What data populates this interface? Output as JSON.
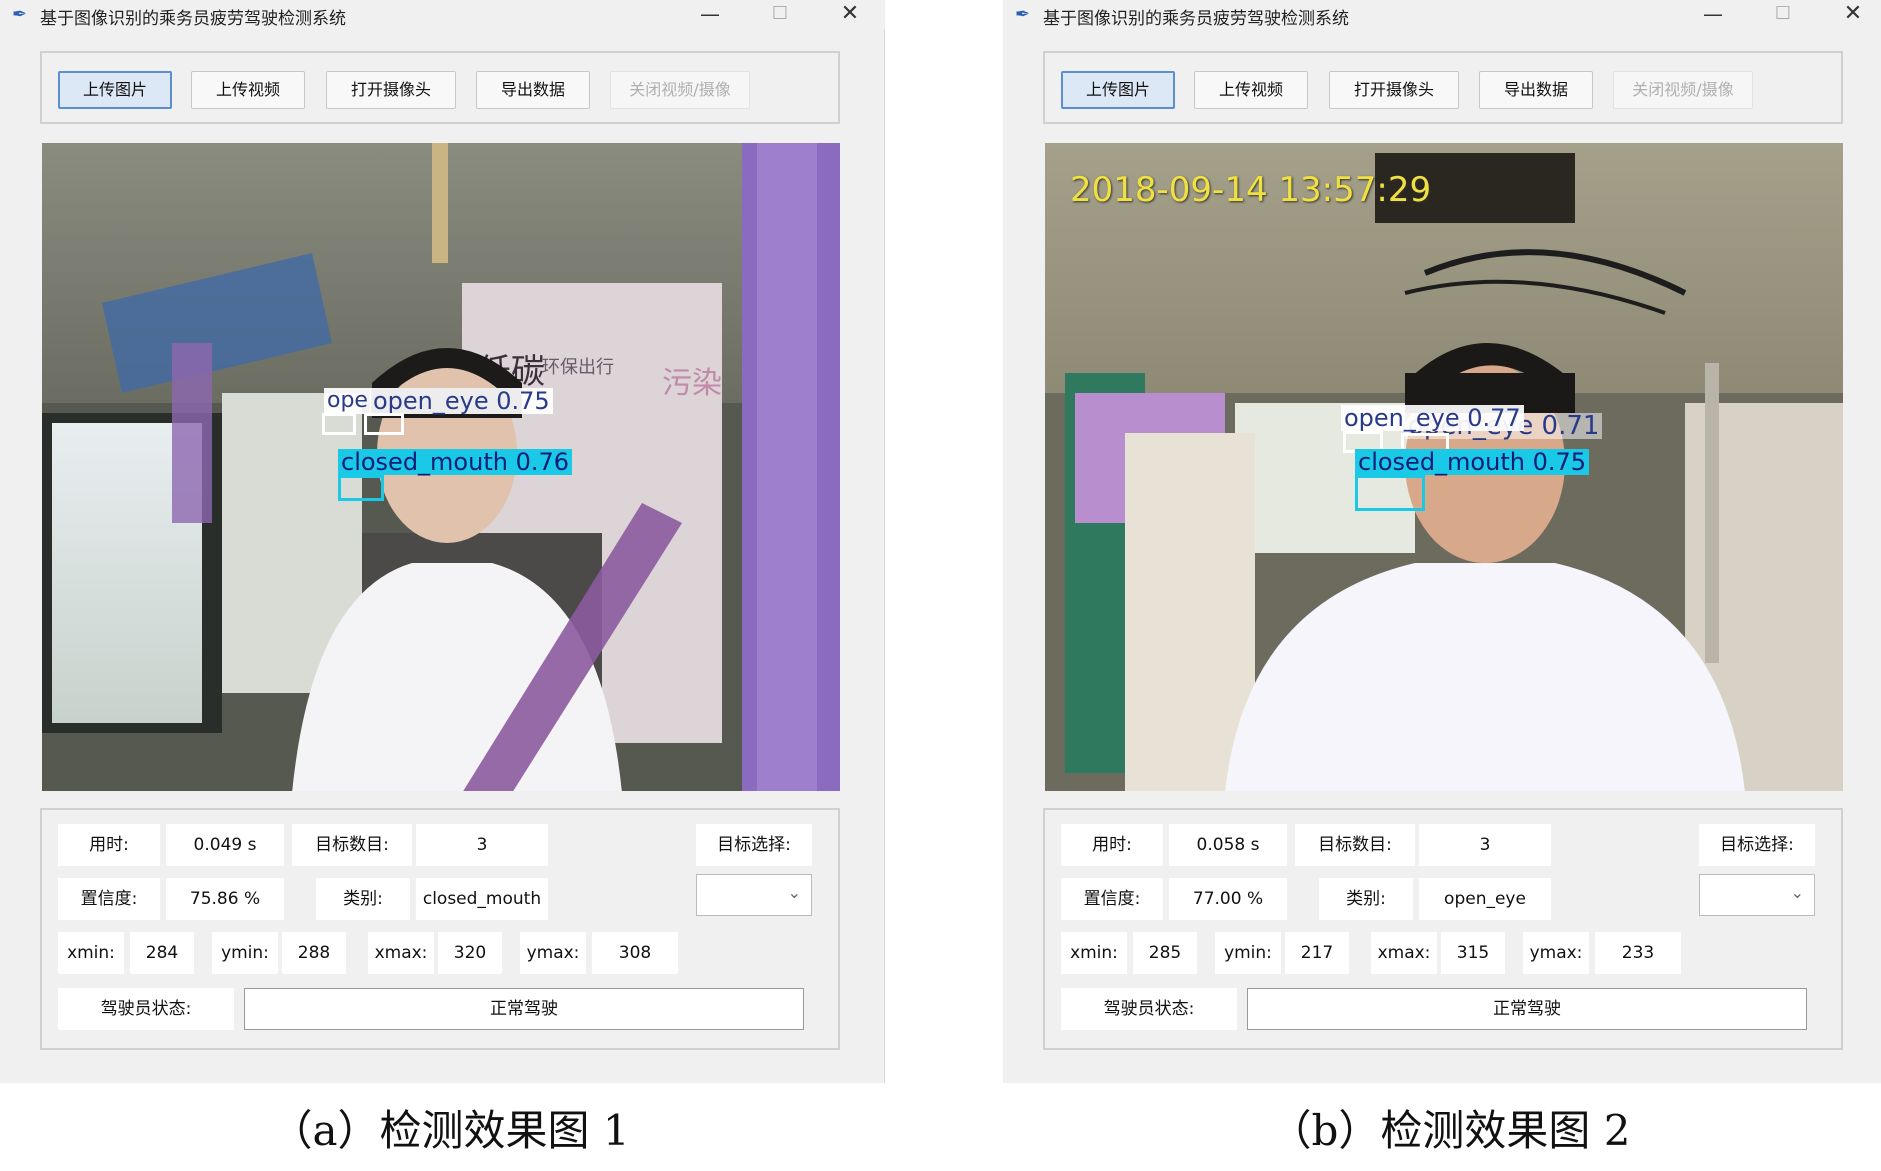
{
  "panels": [
    {
      "window_title": "基于图像识别的乘务员疲劳驾驶检测系统",
      "toolbar": {
        "upload_image": "上传图片",
        "upload_video": "上传视频",
        "open_camera": "打开摄像头",
        "export_data": "导出数据",
        "close_video": "关闭视频/摄像"
      },
      "video": {
        "timestamp": "",
        "detections": [
          {
            "label": "ope",
            "class": "open_eye"
          },
          {
            "label": "open_eye  0.75",
            "class": "open_eye"
          },
          {
            "label": "closed_mouth  0.76",
            "class": "closed_mouth"
          }
        ]
      },
      "info": {
        "time_label": "用时:",
        "time_value": "0.049 s",
        "count_label": "目标数目:",
        "count_value": "3",
        "target_select_label": "目标选择:",
        "confidence_label": "置信度:",
        "confidence_value": "75.86 %",
        "class_label": "类别:",
        "class_value": "closed_mouth",
        "xmin_label": "xmin:",
        "xmin_value": "284",
        "ymin_label": "ymin:",
        "ymin_value": "288",
        "xmax_label": "xmax:",
        "xmax_value": "320",
        "ymax_label": "ymax:",
        "ymax_value": "308",
        "driver_status_label": "驾驶员状态:",
        "driver_status_value": "正常驾驶"
      },
      "caption": "（a）检测效果图 1"
    },
    {
      "window_title": "基于图像识别的乘务员疲劳驾驶检测系统",
      "toolbar": {
        "upload_image": "上传图片",
        "upload_video": "上传视频",
        "open_camera": "打开摄像头",
        "export_data": "导出数据",
        "close_video": "关闭视频/摄像"
      },
      "video": {
        "timestamp": "2018-09-14 13:57:29",
        "detections": [
          {
            "label": "open_eye  0.77",
            "class": "open_eye"
          },
          {
            "label": "open_eye  0.71",
            "class": "open_eye"
          },
          {
            "label": "closed_mouth  0.75",
            "class": "closed_mouth"
          }
        ]
      },
      "info": {
        "time_label": "用时:",
        "time_value": "0.058 s",
        "count_label": "目标数目:",
        "count_value": "3",
        "target_select_label": "目标选择:",
        "confidence_label": "置信度:",
        "confidence_value": "77.00 %",
        "class_label": "类别:",
        "class_value": "open_eye",
        "xmin_label": "xmin:",
        "xmin_value": "285",
        "ymin_label": "ymin:",
        "ymin_value": "217",
        "xmax_label": "xmax:",
        "xmax_value": "315",
        "ymax_label": "ymax:",
        "ymax_value": "233",
        "driver_status_label": "驾驶员状态:",
        "driver_status_value": "正常驾驶"
      },
      "caption": "（b）检测效果图 2"
    }
  ],
  "colors": {
    "window_bg": "#f0f0f0",
    "selected_button_border": "#5a8fd0",
    "selected_button_bg": "#dce8f6",
    "eye_box": "#ffffff",
    "mouth_box": "#19c9e6",
    "timestamp_text": "#f0e040"
  },
  "icons": [
    "feather-app-icon",
    "minimize-icon",
    "maximize-icon",
    "close-icon",
    "chevron-down-icon"
  ]
}
